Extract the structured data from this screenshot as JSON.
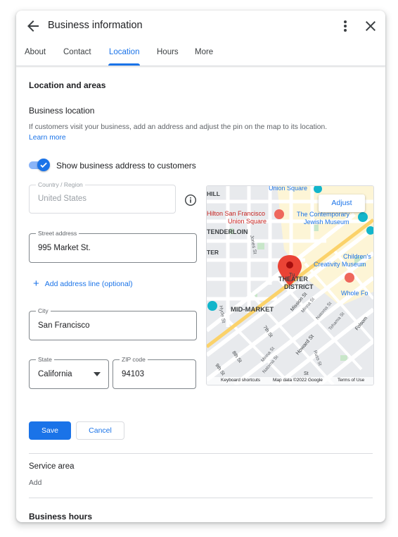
{
  "header": {
    "title": "Business information"
  },
  "tabs": [
    {
      "label": "About"
    },
    {
      "label": "Contact"
    },
    {
      "label": "Location"
    },
    {
      "label": "Hours"
    },
    {
      "label": "More"
    }
  ],
  "section": {
    "title": "Location and areas",
    "business_location": {
      "title": "Business location",
      "description": "If customers visit your business, add an address and adjust the pin on the map to its location.",
      "learn_more": "Learn more",
      "toggle_label": "Show business address to customers",
      "toggle_on": true
    }
  },
  "form": {
    "country": {
      "label": "Country / Region",
      "value": "United States"
    },
    "street": {
      "label": "Street address",
      "value": "995 Market St."
    },
    "add_line": "Add address line (optional)",
    "city": {
      "label": "City",
      "value": "San Francisco"
    },
    "state": {
      "label": "State",
      "value": "California"
    },
    "zip": {
      "label": "ZIP code",
      "value": "94103"
    }
  },
  "map": {
    "adjust_label": "Adjust",
    "labels": {
      "union_square_top": "Union Square",
      "hilton": "Hilton San Francisco",
      "hilton2": "Union Square",
      "contemporary": "The Contemporary",
      "jewish": "Jewish Museum",
      "tenderloin": "TENDERLOIN",
      "childrens": "Children's",
      "creativity": "Creativity Museum",
      "theater1": "THEATER",
      "theater2": "DISTRICT",
      "whole_foods": "Whole Fo",
      "mid_market": "MID-MARKET",
      "hill": "HILL",
      "ter": "TER",
      "jones_st": "Jones St",
      "hyde_st": "Hyde St",
      "mission_st": "Mission St",
      "minna": "Minna St",
      "natoma": "Natoma St",
      "tehama": "Tehama St",
      "folsom": "Folsom",
      "seventh": "7th St",
      "eighth": "8th St",
      "ninth": "9th St",
      "howard": "Howard St",
      "russ": "Russ St",
      "minna2": "Minna St",
      "natoma2": "Natoma St",
      "tu": "Tu",
      "st": "St"
    },
    "attribution": {
      "shortcuts": "Keyboard shortcuts",
      "data": "Map data ©2022 Google",
      "terms": "Terms of Use"
    }
  },
  "actions": {
    "save": "Save",
    "cancel": "Cancel"
  },
  "service_area": {
    "title": "Service area",
    "value": "Add"
  },
  "business_hours": {
    "title": "Business hours"
  }
}
